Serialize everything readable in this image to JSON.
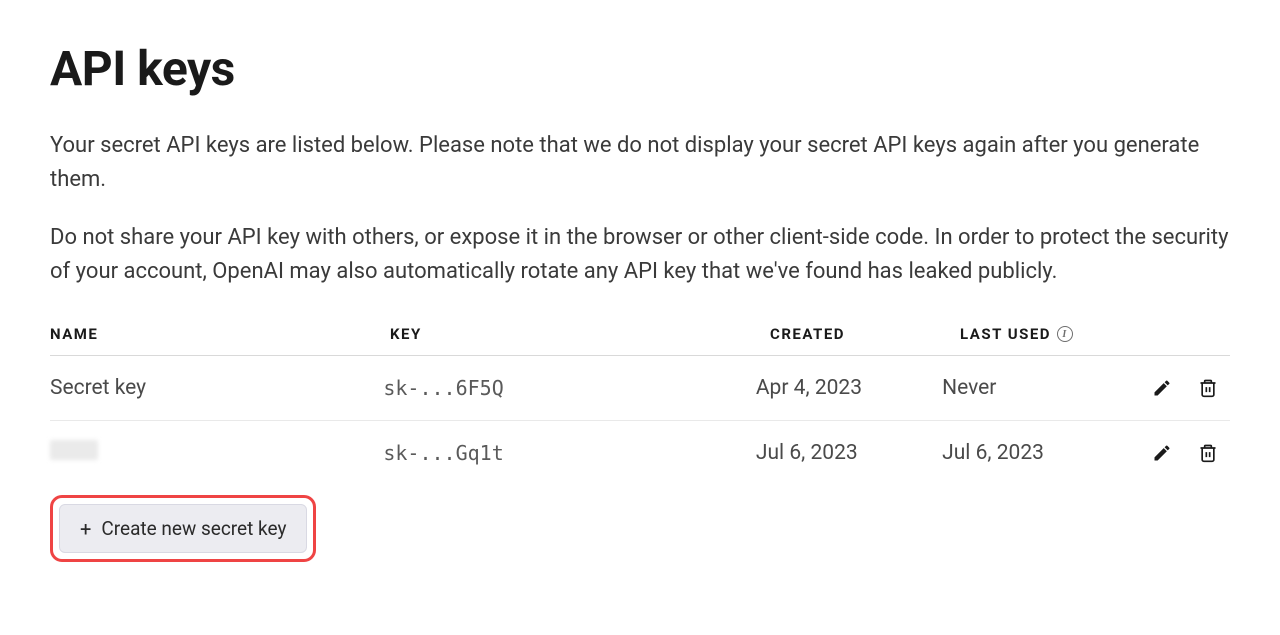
{
  "page": {
    "title": "API keys",
    "description1": "Your secret API keys are listed below. Please note that we do not display your secret API keys again after you generate them.",
    "description2": "Do not share your API key with others, or expose it in the browser or other client-side code. In order to protect the security of your account, OpenAI may also automatically rotate any API key that we've found has leaked publicly."
  },
  "table": {
    "headers": {
      "name": "NAME",
      "key": "KEY",
      "created": "CREATED",
      "last_used": "LAST USED"
    },
    "rows": [
      {
        "name": "Secret key",
        "key": "sk-...6F5Q",
        "created": "Apr 4, 2023",
        "last_used": "Never",
        "redacted": false
      },
      {
        "name": "",
        "key": "sk-...Gq1t",
        "created": "Jul 6, 2023",
        "last_used": "Jul 6, 2023",
        "redacted": true
      }
    ]
  },
  "actions": {
    "create_label": "Create new secret key",
    "plus": "+"
  }
}
